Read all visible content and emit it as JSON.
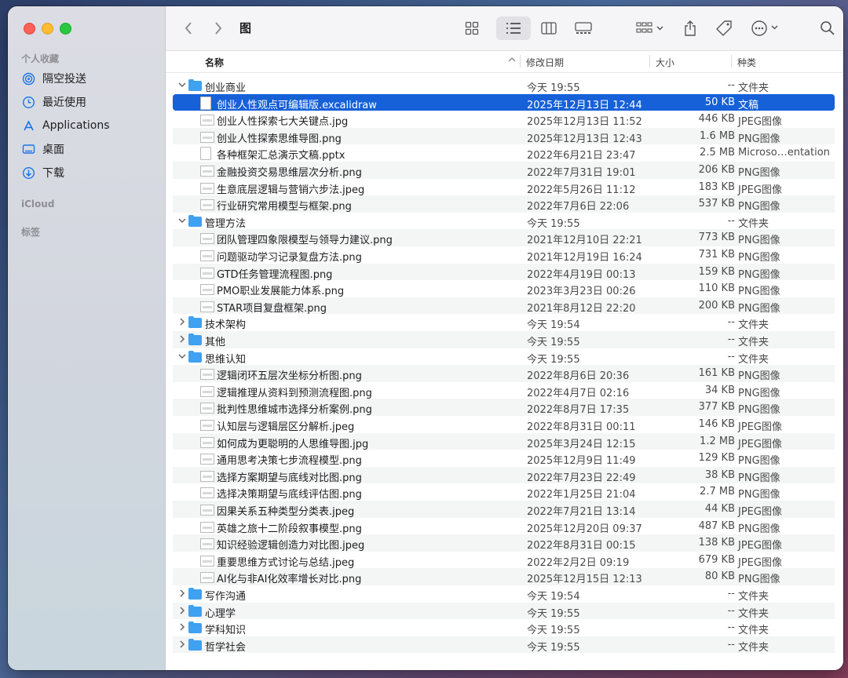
{
  "window": {
    "title": "图",
    "colors": {
      "accent": "#1660d8",
      "folder": "#3ea1f2"
    }
  },
  "sidebar": {
    "favorites_heading": "个人收藏",
    "items": [
      {
        "label": "隔空投送",
        "icon": "airdrop-icon"
      },
      {
        "label": "最近使用",
        "icon": "clock-icon"
      },
      {
        "label": "Applications",
        "icon": "applications-icon"
      },
      {
        "label": "桌面",
        "icon": "desktop-icon"
      },
      {
        "label": "下载",
        "icon": "download-icon"
      }
    ],
    "icloud_heading": "iCloud",
    "tags_heading": "标签"
  },
  "columns": {
    "name": "名称",
    "date": "修改日期",
    "size": "大小",
    "kind": "种类"
  },
  "rows": [
    {
      "type": "folder",
      "level": 0,
      "expanded": true,
      "name": "创业商业",
      "date": "今天 19:55",
      "size": "--",
      "kind": "文件夹"
    },
    {
      "type": "file",
      "level": 1,
      "selected": true,
      "name": "创业人性观点可编辑版.excalidraw",
      "date": "2025年12月13日 12:44",
      "size": "50 KB",
      "kind": "文稿"
    },
    {
      "type": "file",
      "level": 1,
      "name": "创业人性探索七大关键点.jpg",
      "date": "2025年12月13日 11:52",
      "size": "446 KB",
      "kind": "JPEG图像"
    },
    {
      "type": "file",
      "level": 1,
      "name": "创业人性探索思维导图.png",
      "date": "2025年12月13日 12:43",
      "size": "1.6 MB",
      "kind": "PNG图像"
    },
    {
      "type": "file",
      "level": 1,
      "name": "各种框架汇总演示文稿.pptx",
      "date": "2022年6月21日 23:47",
      "size": "2.5 MB",
      "kind": "Microso…entation"
    },
    {
      "type": "file",
      "level": 1,
      "name": "金融投资交易思维层次分析.png",
      "date": "2022年7月31日 19:01",
      "size": "206 KB",
      "kind": "PNG图像"
    },
    {
      "type": "file",
      "level": 1,
      "name": "生意底层逻辑与营销六步法.jpeg",
      "date": "2022年5月26日 11:12",
      "size": "183 KB",
      "kind": "JPEG图像"
    },
    {
      "type": "file",
      "level": 1,
      "name": "行业研究常用模型与框架.png",
      "date": "2022年7月6日 22:06",
      "size": "537 KB",
      "kind": "PNG图像"
    },
    {
      "type": "folder",
      "level": 0,
      "expanded": true,
      "name": "管理方法",
      "date": "今天 19:55",
      "size": "--",
      "kind": "文件夹"
    },
    {
      "type": "file",
      "level": 1,
      "name": "团队管理四象限模型与领导力建议.png",
      "date": "2021年12月10日 22:21",
      "size": "773 KB",
      "kind": "PNG图像"
    },
    {
      "type": "file",
      "level": 1,
      "name": "问题驱动学习记录复盘方法.png",
      "date": "2021年12月19日 16:24",
      "size": "731 KB",
      "kind": "PNG图像"
    },
    {
      "type": "file",
      "level": 1,
      "name": "GTD任务管理流程图.png",
      "date": "2022年4月19日 00:13",
      "size": "159 KB",
      "kind": "PNG图像"
    },
    {
      "type": "file",
      "level": 1,
      "name": "PMO职业发展能力体系.png",
      "date": "2023年3月23日 00:26",
      "size": "110 KB",
      "kind": "PNG图像"
    },
    {
      "type": "file",
      "level": 1,
      "name": "STAR项目复盘框架.png",
      "date": "2021年8月12日 22:20",
      "size": "200 KB",
      "kind": "PNG图像"
    },
    {
      "type": "folder",
      "level": 0,
      "expanded": false,
      "name": "技术架构",
      "date": "今天 19:54",
      "size": "--",
      "kind": "文件夹"
    },
    {
      "type": "folder",
      "level": 0,
      "expanded": false,
      "name": "其他",
      "date": "今天 19:55",
      "size": "--",
      "kind": "文件夹"
    },
    {
      "type": "folder",
      "level": 0,
      "expanded": true,
      "name": "思维认知",
      "date": "今天 19:55",
      "size": "--",
      "kind": "文件夹"
    },
    {
      "type": "file",
      "level": 1,
      "name": "逻辑闭环五层次坐标分析图.png",
      "date": "2022年8月6日 20:36",
      "size": "161 KB",
      "kind": "PNG图像"
    },
    {
      "type": "file",
      "level": 1,
      "name": "逻辑推理从资料到预测流程图.png",
      "date": "2022年4月7日 02:16",
      "size": "34 KB",
      "kind": "PNG图像"
    },
    {
      "type": "file",
      "level": 1,
      "name": "批判性思维城市选择分析案例.png",
      "date": "2022年8月7日 17:35",
      "size": "377 KB",
      "kind": "PNG图像"
    },
    {
      "type": "file",
      "level": 1,
      "name": "认知层与逻辑层区分解析.jpeg",
      "date": "2022年8月31日 00:11",
      "size": "146 KB",
      "kind": "JPEG图像"
    },
    {
      "type": "file",
      "level": 1,
      "name": "如何成为更聪明的人思维导图.jpg",
      "date": "2025年3月24日 12:15",
      "size": "1.2 MB",
      "kind": "JPEG图像"
    },
    {
      "type": "file",
      "level": 1,
      "name": "通用思考决策七步流程模型.png",
      "date": "2025年12月9日 11:49",
      "size": "129 KB",
      "kind": "PNG图像"
    },
    {
      "type": "file",
      "level": 1,
      "name": "选择方案期望与底线对比图.png",
      "date": "2022年7月23日 22:49",
      "size": "38 KB",
      "kind": "PNG图像"
    },
    {
      "type": "file",
      "level": 1,
      "name": "选择决策期望与底线评估图.png",
      "date": "2022年1月25日 21:04",
      "size": "2.7 MB",
      "kind": "PNG图像"
    },
    {
      "type": "file",
      "level": 1,
      "name": "因果关系五种类型分类表.jpeg",
      "date": "2022年7月21日 13:14",
      "size": "44 KB",
      "kind": "JPEG图像"
    },
    {
      "type": "file",
      "level": 1,
      "name": "英雄之旅十二阶段叙事模型.png",
      "date": "2025年12月20日 09:37",
      "size": "487 KB",
      "kind": "PNG图像"
    },
    {
      "type": "file",
      "level": 1,
      "name": "知识经验逻辑创造力对比图.jpeg",
      "date": "2022年8月31日 00:15",
      "size": "138 KB",
      "kind": "JPEG图像"
    },
    {
      "type": "file",
      "level": 1,
      "name": "重要思维方式讨论与总结.jpeg",
      "date": "2022年2月2日 09:19",
      "size": "679 KB",
      "kind": "JPEG图像"
    },
    {
      "type": "file",
      "level": 1,
      "name": "AI化与非AI化效率增长对比.png",
      "date": "2025年12月15日 12:13",
      "size": "80 KB",
      "kind": "PNG图像"
    },
    {
      "type": "folder",
      "level": 0,
      "expanded": false,
      "name": "写作沟通",
      "date": "今天 19:54",
      "size": "--",
      "kind": "文件夹"
    },
    {
      "type": "folder",
      "level": 0,
      "expanded": false,
      "name": "心理学",
      "date": "今天 19:55",
      "size": "--",
      "kind": "文件夹"
    },
    {
      "type": "folder",
      "level": 0,
      "expanded": false,
      "name": "学科知识",
      "date": "今天 19:55",
      "size": "--",
      "kind": "文件夹"
    },
    {
      "type": "folder",
      "level": 0,
      "expanded": false,
      "name": "哲学社会",
      "date": "今天 19:55",
      "size": "--",
      "kind": "文件夹"
    }
  ]
}
